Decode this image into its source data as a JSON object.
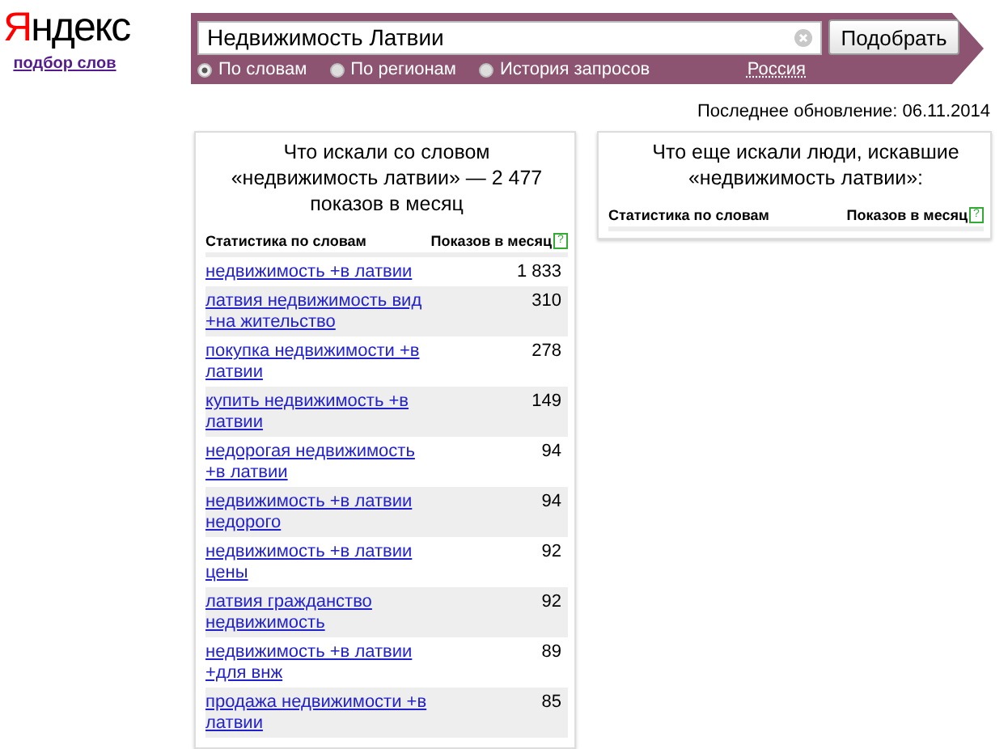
{
  "logo": {
    "first": "Я",
    "rest": "ндекс"
  },
  "subtitle_link": "подбор слов",
  "search": {
    "value": "Недвижимость Латвии",
    "button": "Подобрать"
  },
  "modes": [
    {
      "label": "По словам",
      "selected": true
    },
    {
      "label": "По регионам",
      "selected": false
    },
    {
      "label": "История запросов",
      "selected": false
    }
  ],
  "region_link": "Россия",
  "last_update": "Последнее обновление: 06.11.2014",
  "left_panel": {
    "title": "Что искали со словом «недвижимость латвии» — 2 477 показов в месяц",
    "columns": [
      "Статистика по словам",
      "Показов в месяц"
    ],
    "help_mark": "?",
    "rows": [
      {
        "phrase": "недвижимость +в латвии",
        "count": "1 833"
      },
      {
        "phrase": "латвия недвижимость вид +на жительство",
        "count": "310"
      },
      {
        "phrase": "покупка недвижимости +в латвии",
        "count": "278"
      },
      {
        "phrase": "купить недвижимость +в латвии",
        "count": "149"
      },
      {
        "phrase": "недорогая недвижимость +в латвии",
        "count": "94"
      },
      {
        "phrase": "недвижимость +в латвии недорого",
        "count": "94"
      },
      {
        "phrase": "недвижимость +в латвии цены",
        "count": "92"
      },
      {
        "phrase": "латвия гражданство недвижимость",
        "count": "92"
      },
      {
        "phrase": "недвижимость +в латвии +для внж",
        "count": "89"
      },
      {
        "phrase": "продажа недвижимости +в латвии",
        "count": "85"
      }
    ]
  },
  "right_panel": {
    "title": "Что еще искали люди, искавшие «недвижимость латвии»:",
    "columns": [
      "Статистика по словам",
      "Показов в месяц"
    ],
    "help_mark": "?"
  }
}
